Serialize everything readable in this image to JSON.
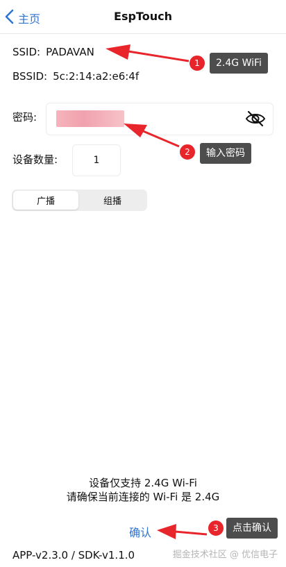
{
  "nav": {
    "back_label": "主页",
    "title": "EspTouch"
  },
  "wifi": {
    "ssid_label": "SSID:",
    "ssid_value": "PADAVAN",
    "bssid_label": "BSSID:",
    "bssid_value": "5c:2:14:a2:e6:4f"
  },
  "password": {
    "label": "密码:",
    "icon": "eye-slash-icon"
  },
  "device_count": {
    "label": "设备数量:",
    "value": "1"
  },
  "mode": {
    "options": [
      "广播",
      "组播"
    ],
    "selected": "广播"
  },
  "notice": {
    "line1": "设备仅支持 2.4G Wi-Fi",
    "line2": "请确保当前连接的 Wi-Fi 是 2.4G"
  },
  "confirm_label": "确认",
  "version_text": "APP-v2.3.0 / SDK-v1.1.0",
  "watermark": "掘金技术社区 @ 优信电子",
  "annotations": {
    "step1": {
      "number": "1",
      "text": "2.4G WiFi"
    },
    "step2": {
      "number": "2",
      "text": "输入密码"
    },
    "step3": {
      "number": "3",
      "text": "点击确认"
    }
  },
  "colors": {
    "link_blue": "#2f74d0",
    "badge_red": "#e8252b",
    "tag_gray": "#4d4d4d",
    "masked_pink": "#f0a2ad"
  }
}
